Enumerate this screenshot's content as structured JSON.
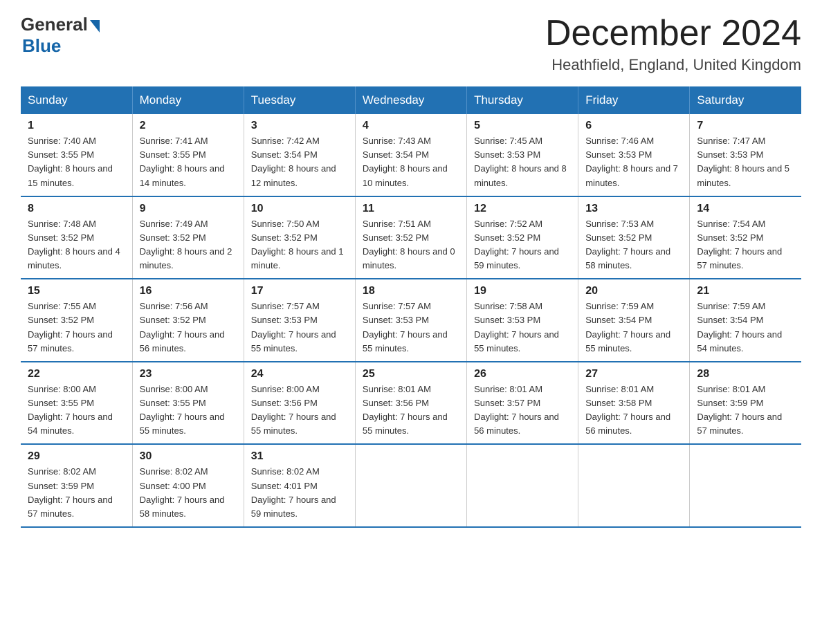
{
  "header": {
    "logo_general": "General",
    "logo_blue": "Blue",
    "month_title": "December 2024",
    "location": "Heathfield, England, United Kingdom"
  },
  "days_of_week": [
    "Sunday",
    "Monday",
    "Tuesday",
    "Wednesday",
    "Thursday",
    "Friday",
    "Saturday"
  ],
  "weeks": [
    [
      {
        "day": "1",
        "sunrise": "7:40 AM",
        "sunset": "3:55 PM",
        "daylight": "8 hours and 15 minutes."
      },
      {
        "day": "2",
        "sunrise": "7:41 AM",
        "sunset": "3:55 PM",
        "daylight": "8 hours and 14 minutes."
      },
      {
        "day": "3",
        "sunrise": "7:42 AM",
        "sunset": "3:54 PM",
        "daylight": "8 hours and 12 minutes."
      },
      {
        "day": "4",
        "sunrise": "7:43 AM",
        "sunset": "3:54 PM",
        "daylight": "8 hours and 10 minutes."
      },
      {
        "day": "5",
        "sunrise": "7:45 AM",
        "sunset": "3:53 PM",
        "daylight": "8 hours and 8 minutes."
      },
      {
        "day": "6",
        "sunrise": "7:46 AM",
        "sunset": "3:53 PM",
        "daylight": "8 hours and 7 minutes."
      },
      {
        "day": "7",
        "sunrise": "7:47 AM",
        "sunset": "3:53 PM",
        "daylight": "8 hours and 5 minutes."
      }
    ],
    [
      {
        "day": "8",
        "sunrise": "7:48 AM",
        "sunset": "3:52 PM",
        "daylight": "8 hours and 4 minutes."
      },
      {
        "day": "9",
        "sunrise": "7:49 AM",
        "sunset": "3:52 PM",
        "daylight": "8 hours and 2 minutes."
      },
      {
        "day": "10",
        "sunrise": "7:50 AM",
        "sunset": "3:52 PM",
        "daylight": "8 hours and 1 minute."
      },
      {
        "day": "11",
        "sunrise": "7:51 AM",
        "sunset": "3:52 PM",
        "daylight": "8 hours and 0 minutes."
      },
      {
        "day": "12",
        "sunrise": "7:52 AM",
        "sunset": "3:52 PM",
        "daylight": "7 hours and 59 minutes."
      },
      {
        "day": "13",
        "sunrise": "7:53 AM",
        "sunset": "3:52 PM",
        "daylight": "7 hours and 58 minutes."
      },
      {
        "day": "14",
        "sunrise": "7:54 AM",
        "sunset": "3:52 PM",
        "daylight": "7 hours and 57 minutes."
      }
    ],
    [
      {
        "day": "15",
        "sunrise": "7:55 AM",
        "sunset": "3:52 PM",
        "daylight": "7 hours and 57 minutes."
      },
      {
        "day": "16",
        "sunrise": "7:56 AM",
        "sunset": "3:52 PM",
        "daylight": "7 hours and 56 minutes."
      },
      {
        "day": "17",
        "sunrise": "7:57 AM",
        "sunset": "3:53 PM",
        "daylight": "7 hours and 55 minutes."
      },
      {
        "day": "18",
        "sunrise": "7:57 AM",
        "sunset": "3:53 PM",
        "daylight": "7 hours and 55 minutes."
      },
      {
        "day": "19",
        "sunrise": "7:58 AM",
        "sunset": "3:53 PM",
        "daylight": "7 hours and 55 minutes."
      },
      {
        "day": "20",
        "sunrise": "7:59 AM",
        "sunset": "3:54 PM",
        "daylight": "7 hours and 55 minutes."
      },
      {
        "day": "21",
        "sunrise": "7:59 AM",
        "sunset": "3:54 PM",
        "daylight": "7 hours and 54 minutes."
      }
    ],
    [
      {
        "day": "22",
        "sunrise": "8:00 AM",
        "sunset": "3:55 PM",
        "daylight": "7 hours and 54 minutes."
      },
      {
        "day": "23",
        "sunrise": "8:00 AM",
        "sunset": "3:55 PM",
        "daylight": "7 hours and 55 minutes."
      },
      {
        "day": "24",
        "sunrise": "8:00 AM",
        "sunset": "3:56 PM",
        "daylight": "7 hours and 55 minutes."
      },
      {
        "day": "25",
        "sunrise": "8:01 AM",
        "sunset": "3:56 PM",
        "daylight": "7 hours and 55 minutes."
      },
      {
        "day": "26",
        "sunrise": "8:01 AM",
        "sunset": "3:57 PM",
        "daylight": "7 hours and 56 minutes."
      },
      {
        "day": "27",
        "sunrise": "8:01 AM",
        "sunset": "3:58 PM",
        "daylight": "7 hours and 56 minutes."
      },
      {
        "day": "28",
        "sunrise": "8:01 AM",
        "sunset": "3:59 PM",
        "daylight": "7 hours and 57 minutes."
      }
    ],
    [
      {
        "day": "29",
        "sunrise": "8:02 AM",
        "sunset": "3:59 PM",
        "daylight": "7 hours and 57 minutes."
      },
      {
        "day": "30",
        "sunrise": "8:02 AM",
        "sunset": "4:00 PM",
        "daylight": "7 hours and 58 minutes."
      },
      {
        "day": "31",
        "sunrise": "8:02 AM",
        "sunset": "4:01 PM",
        "daylight": "7 hours and 59 minutes."
      },
      null,
      null,
      null,
      null
    ]
  ]
}
